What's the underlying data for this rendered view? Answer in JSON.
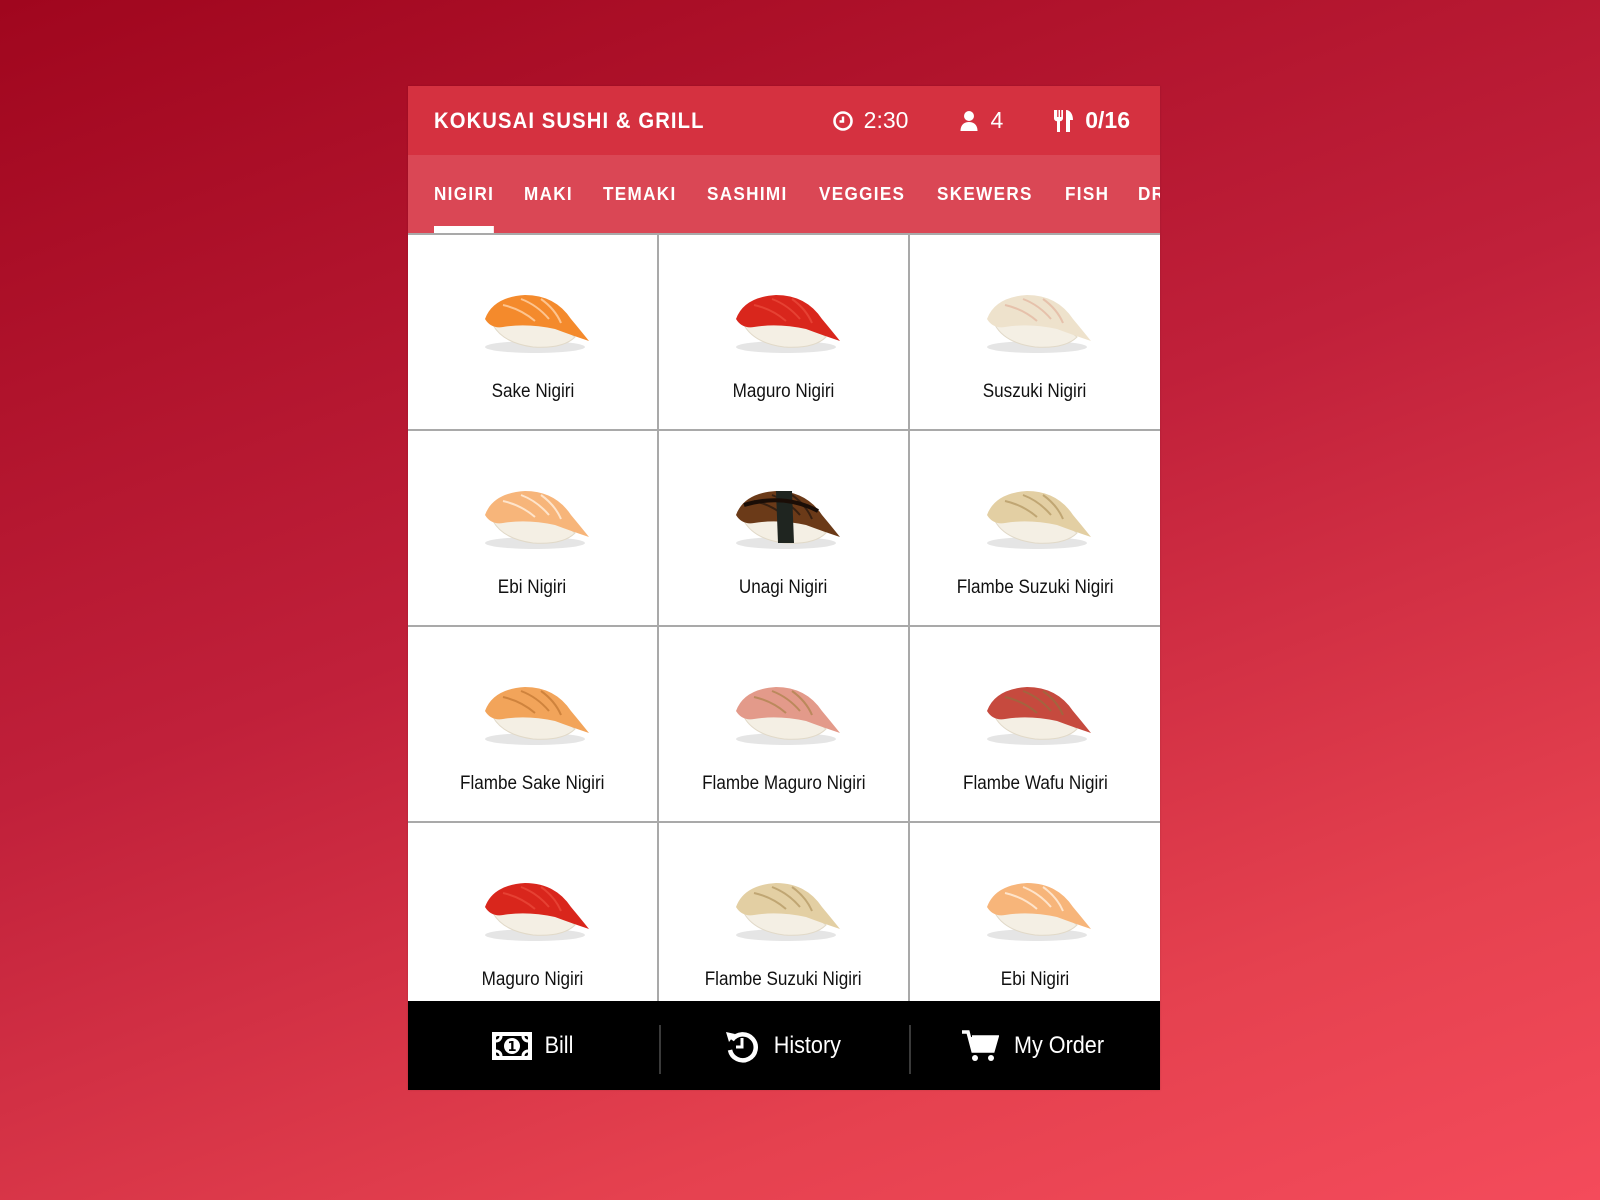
{
  "header": {
    "title": "KOKUSAI SUSHI & GRILL",
    "timer": {
      "icon": "clock-icon",
      "value": "2:30"
    },
    "guests": {
      "icon": "user-icon",
      "value": "4"
    },
    "orders": {
      "icon": "utensils-icon",
      "value": "0/16"
    }
  },
  "tabs": [
    {
      "label": "NIGIRI",
      "active": true
    },
    {
      "label": "MAKI",
      "active": false
    },
    {
      "label": "TEMAKI",
      "active": false
    },
    {
      "label": "SASHIMI",
      "active": false
    },
    {
      "label": "VEGGIES",
      "active": false
    },
    {
      "label": "SKEWERS",
      "active": false
    },
    {
      "label": "FISH",
      "active": false
    },
    {
      "label": "DRINKS",
      "active": false
    }
  ],
  "items": [
    {
      "name": "Sake Nigiri",
      "fish": "#f48a2c",
      "stripe": "#ffd2a8"
    },
    {
      "name": "Maguro Nigiri",
      "fish": "#d9261c",
      "stripe": "#e8493a"
    },
    {
      "name": "Suszuki Nigiri",
      "fish": "#eee2cc",
      "stripe": "#e4b9a3"
    },
    {
      "name": "Ebi Nigiri",
      "fish": "#f7b57a",
      "stripe": "#fff0e0"
    },
    {
      "name": "Unagi Nigiri",
      "fish": "#6b3a18",
      "stripe": "#2a1a10"
    },
    {
      "name": "Flambe Suzuki Nigiri",
      "fish": "#e3cfa3",
      "stripe": "#b79b66"
    },
    {
      "name": "Flambe Sake Nigiri",
      "fish": "#f2a45a",
      "stripe": "#c57a36"
    },
    {
      "name": "Flambe Maguro Nigiri",
      "fish": "#e39a8a",
      "stripe": "#b08450"
    },
    {
      "name": "Flambe Wafu Nigiri",
      "fish": "#c64a3e",
      "stripe": "#9a6a3e"
    },
    {
      "name": "Maguro Nigiri",
      "fish": "#d9261c",
      "stripe": "#e8493a"
    },
    {
      "name": "Flambe Suzuki Nigiri",
      "fish": "#e3cfa3",
      "stripe": "#b79b66"
    },
    {
      "name": "Ebi Nigiri",
      "fish": "#f7b57a",
      "stripe": "#fff0e0"
    }
  ],
  "footer": {
    "bill": {
      "label": "Bill",
      "icon": "bill-icon"
    },
    "history": {
      "label": "History",
      "icon": "history-icon"
    },
    "my_order": {
      "label": "My Order",
      "icon": "cart-icon"
    }
  },
  "colors": {
    "header_bg": "#d53140",
    "tabs_bg": "#da4755",
    "footer_bg": "#000000",
    "grid_border": "#a9a9a9"
  }
}
